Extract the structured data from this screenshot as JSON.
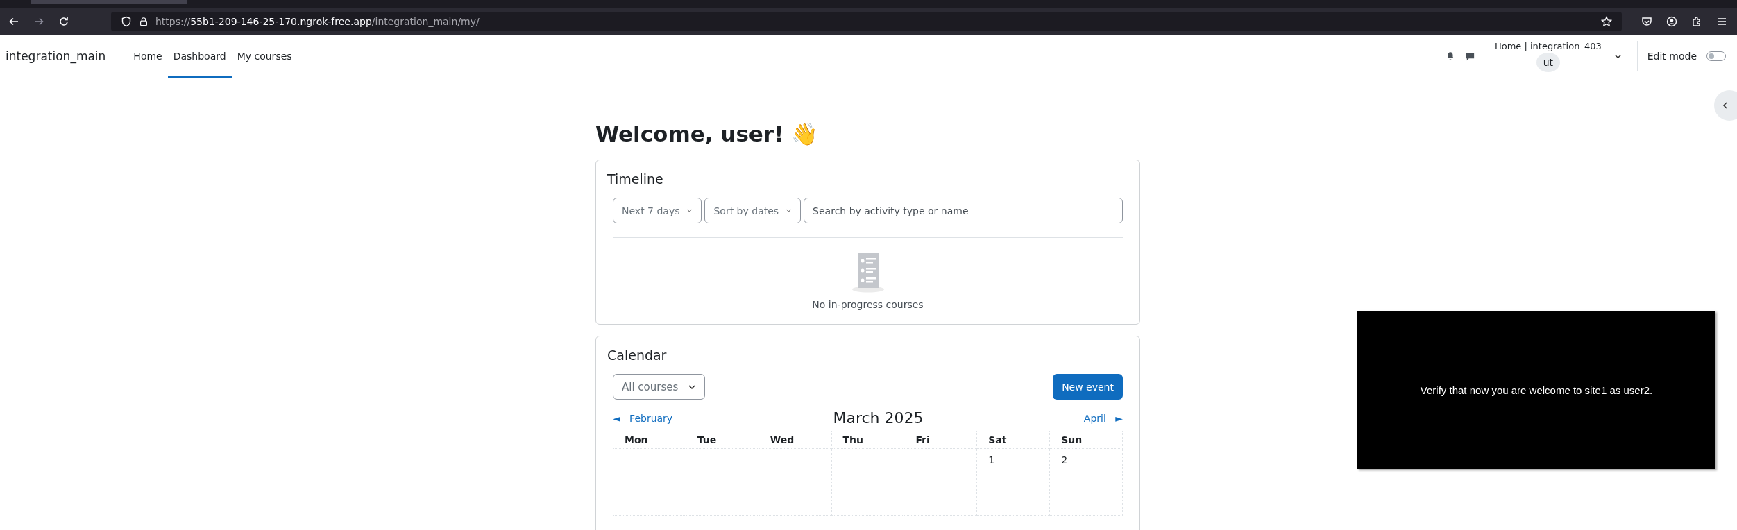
{
  "browser": {
    "url": {
      "scheme": "https://",
      "host": "55b1-209-146-25-170.ngrok-free.app",
      "path": "/integration_main/my/"
    }
  },
  "navbar": {
    "site_name": "integration_main",
    "links": [
      {
        "label": "Home",
        "selected": false
      },
      {
        "label": "Dashboard",
        "selected": true
      },
      {
        "label": "My courses",
        "selected": false
      }
    ],
    "user_menu": {
      "title": "Home | integration_403",
      "initials": "ut"
    },
    "edit_mode": {
      "label": "Edit mode",
      "on": false
    }
  },
  "heading": "Welcome, user! 👋",
  "timeline": {
    "title": "Timeline",
    "filter": "Next 7 days",
    "sort": "Sort by dates",
    "search": {
      "placeholder": "Search by activity type or name"
    },
    "empty_text": "No in-progress courses"
  },
  "calendar": {
    "title": "Calendar",
    "course_filter": "All courses",
    "new_event": "New event",
    "prev": {
      "arrow": "◄",
      "label": "February"
    },
    "month": "March 2025",
    "next": {
      "label": "April",
      "arrow": "►"
    },
    "weekdays": [
      "Mon",
      "Tue",
      "Wed",
      "Thu",
      "Fri",
      "Sat",
      "Sun"
    ],
    "first_week": [
      {
        "kind": "blank"
      },
      {
        "kind": "blank"
      },
      {
        "kind": "blank"
      },
      {
        "kind": "blank"
      },
      {
        "kind": "blank"
      },
      {
        "kind": "day",
        "label": "1"
      },
      {
        "kind": "day",
        "label": "2"
      }
    ]
  },
  "caption": {
    "text": "Verify that now you are welcome to site1 as user2."
  }
}
